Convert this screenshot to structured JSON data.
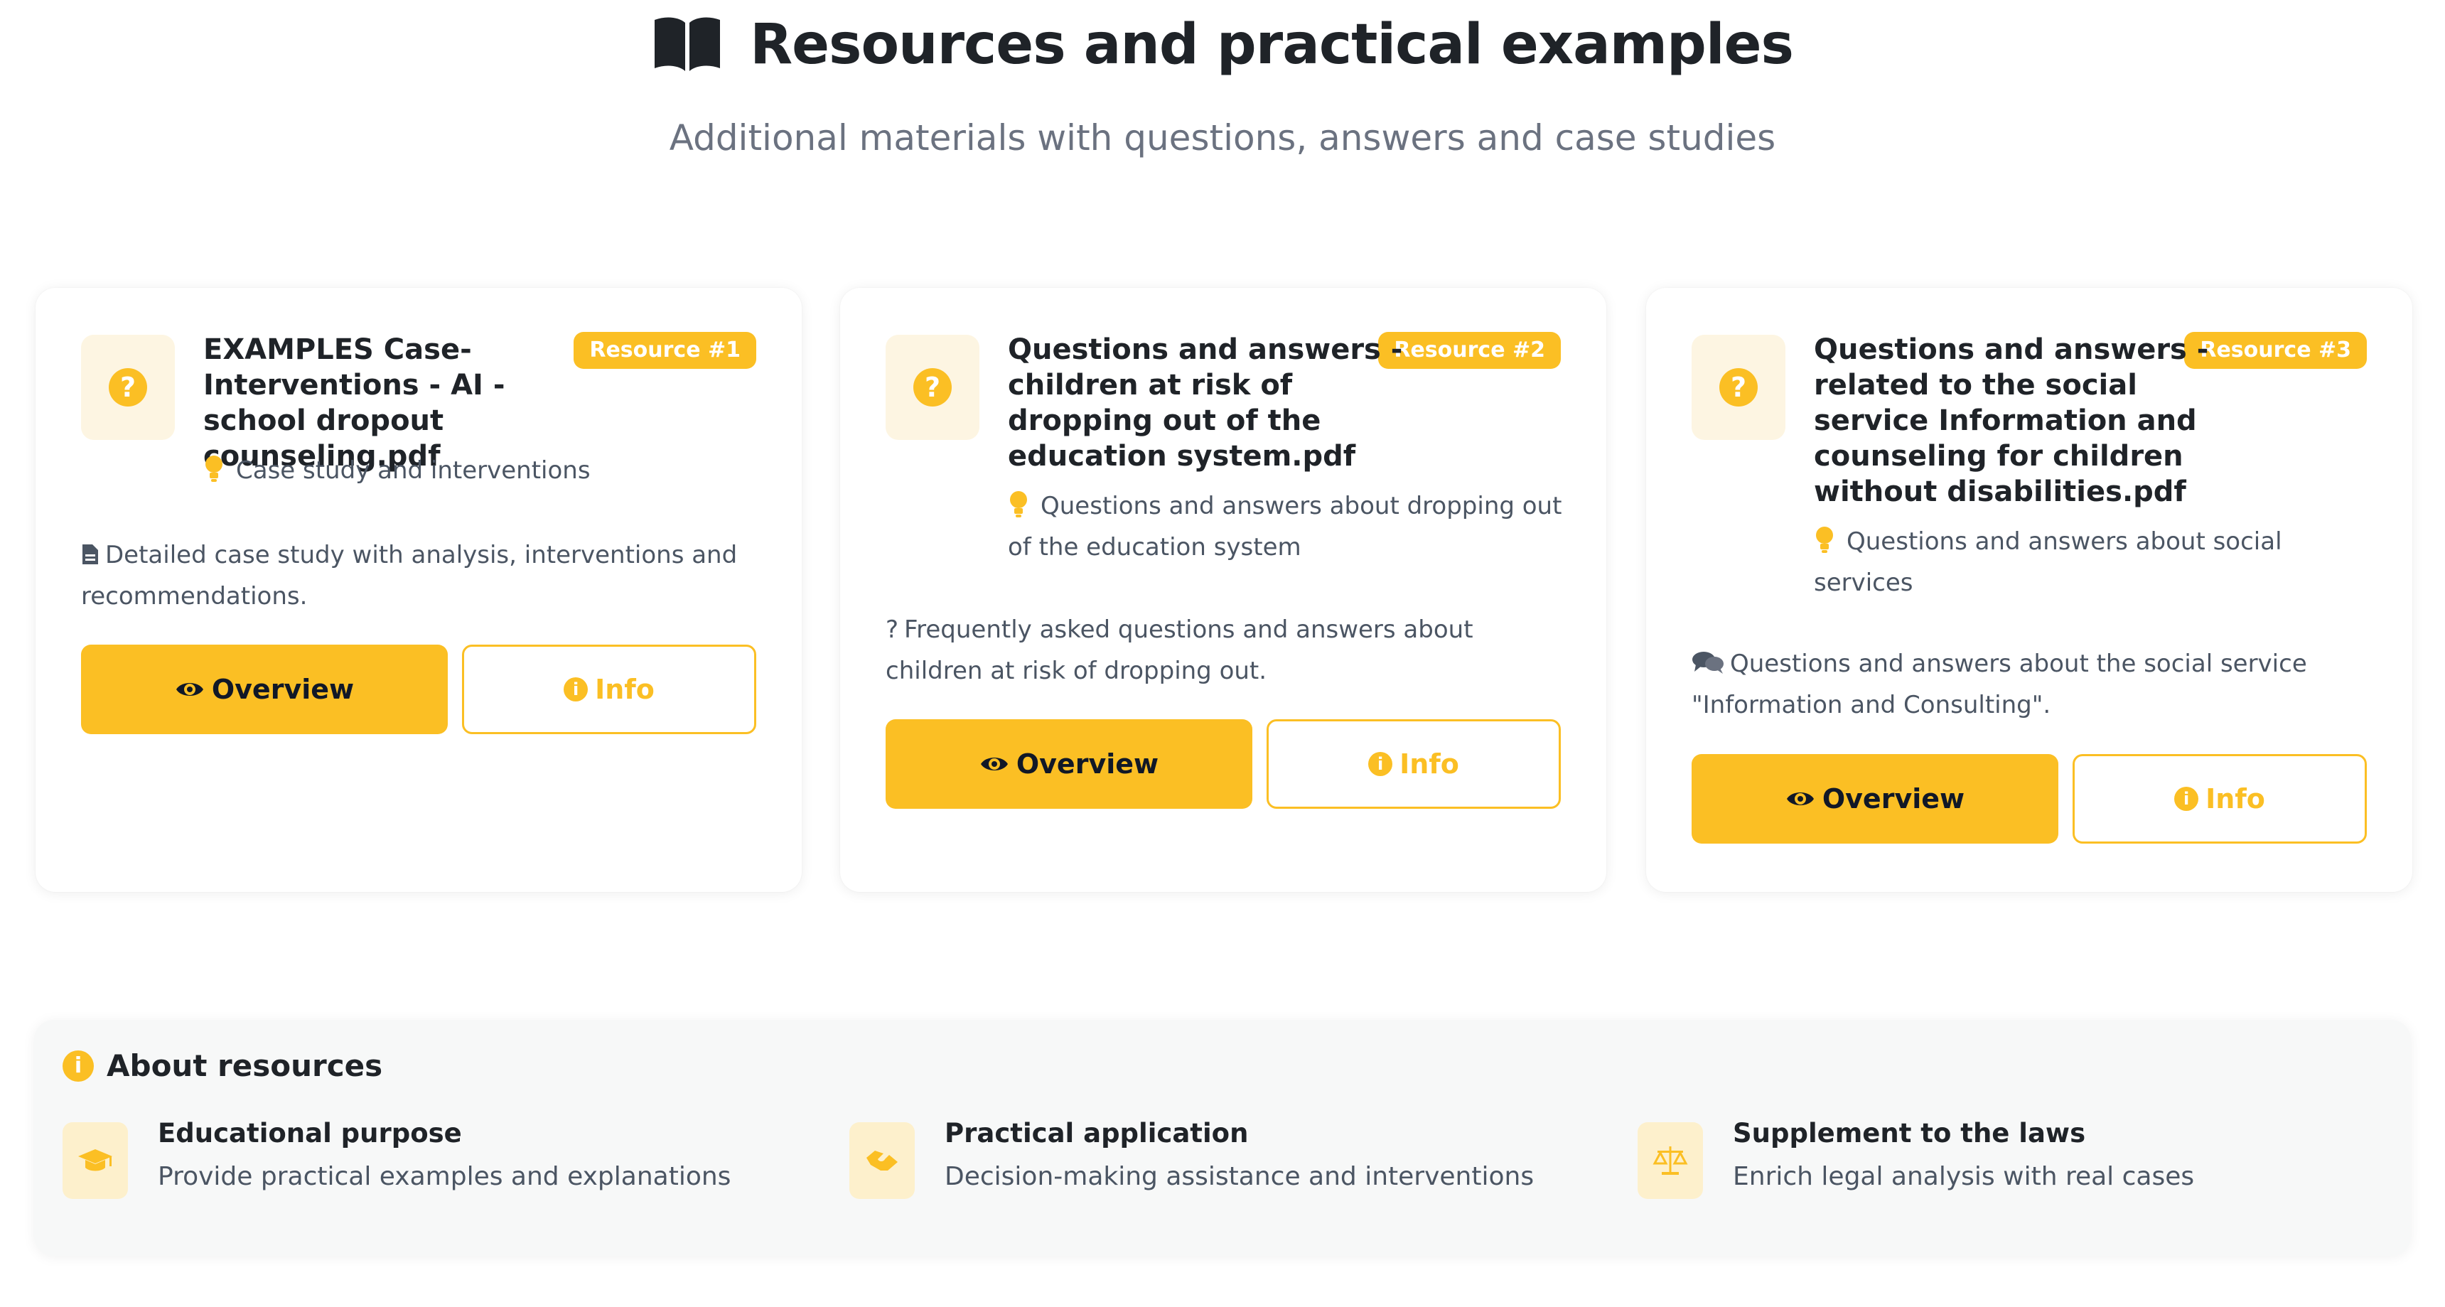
{
  "header": {
    "title": "Resources and practical examples",
    "subtitle": "Additional materials with questions, answers and case studies",
    "icon": "book-open-icon"
  },
  "cards": [
    {
      "badge": "Resource #1",
      "title": "EXAMPLES Case-Interventions - AI - school dropout counseling.pdf",
      "subtitle": "Case study and interventions",
      "description": "Detailed case study with analysis, interventions and recommendations.",
      "description_icon": "file-icon",
      "overview_label": "Overview",
      "info_label": "Info"
    },
    {
      "badge": "Resource #2",
      "title": "Questions and answers - children at risk of dropping out of the education system.pdf",
      "subtitle": "Questions and answers about dropping out of the education system",
      "description": "Frequently asked questions and answers about children at risk of dropping out.",
      "description_icon": "question-icon",
      "overview_label": "Overview",
      "info_label": "Info"
    },
    {
      "badge": "Resource #3",
      "title": "Questions and answers - related to the social service Information and counseling for children without disabilities.pdf",
      "subtitle": "Questions and answers about social services",
      "description": "Questions and answers about the social service \"Information and Consulting\".",
      "description_icon": "comments-icon",
      "overview_label": "Overview",
      "info_label": "Info"
    }
  ],
  "about": {
    "title": "About resources",
    "features": [
      {
        "title": "Educational purpose",
        "text": "Provide practical examples and explanations",
        "icon": "graduation-cap-icon"
      },
      {
        "title": "Practical application",
        "text": "Decision-making assistance and interventions",
        "icon": "handshake-icon"
      },
      {
        "title": "Supplement to the laws",
        "text": "Enrich legal analysis with real cases",
        "icon": "scale-icon"
      }
    ]
  },
  "colors": {
    "accent": "#fbbf24",
    "icon_bg": "#fdf5e2",
    "muted_text": "#6b7280",
    "panel_bg": "#f7f8f8"
  }
}
